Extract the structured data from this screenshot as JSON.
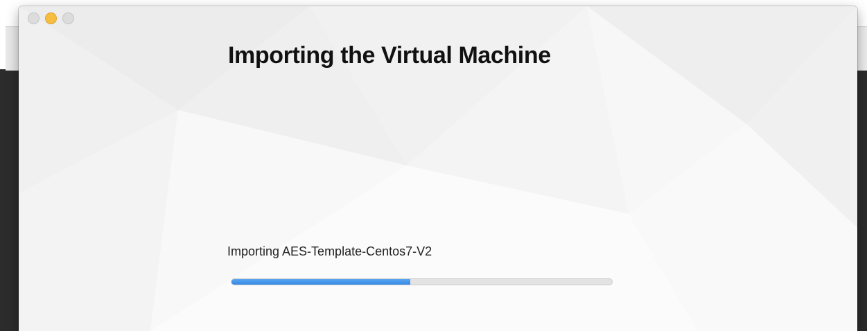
{
  "window": {
    "title": "Importing the Virtual Machine",
    "controls": [
      "close",
      "minimize",
      "zoom"
    ]
  },
  "import": {
    "status_text": "Importing AES-Template-Centos7-V2",
    "progress_fraction": 0.47
  },
  "colors": {
    "progress_fill": "#3b8ee6",
    "progress_track": "#e3e3e3",
    "minimize_light": "#f6be3f",
    "inactive_light": "#dcdcdc"
  }
}
